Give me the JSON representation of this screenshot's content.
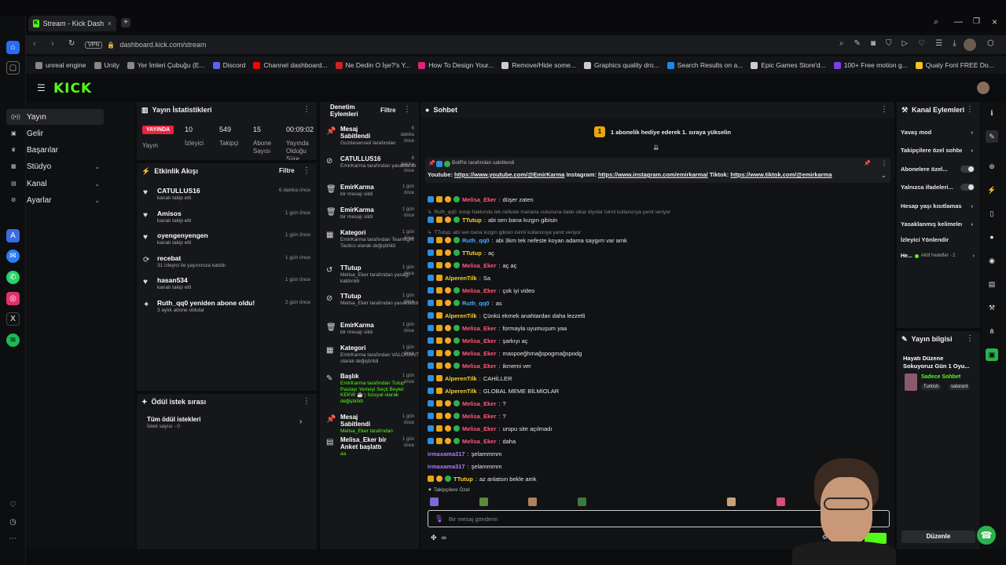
{
  "browser": {
    "tab_title": "Stream - Kick Dashboard",
    "vpn_label": "VPN",
    "url": "dashboard.kick.com/stream",
    "bookmarks": [
      {
        "label": "unreal engine",
        "color": "#888888"
      },
      {
        "label": "Unity",
        "color": "#888888"
      },
      {
        "label": "Yer İmleri Çubuğu (E...",
        "color": "#888888"
      },
      {
        "label": "Discord",
        "color": "#5865f2"
      },
      {
        "label": "Channel dashboard...",
        "color": "#ff0000"
      },
      {
        "label": "Ne Dedin O İşe?'s Y...",
        "color": "#cc2222"
      },
      {
        "label": "How To Design Your...",
        "color": "#e2227a"
      },
      {
        "label": "Remove/Hide some...",
        "color": "#cccccc"
      },
      {
        "label": "Graphics quality dro...",
        "color": "#cccccc"
      },
      {
        "label": "Search Results on a...",
        "color": "#1e88e5"
      },
      {
        "label": "Epic Games Store'd...",
        "color": "#cccccc"
      },
      {
        "label": "100+ Free motion g...",
        "color": "#7b3fe4"
      },
      {
        "label": "Qualy Font FREE Do...",
        "color": "#f5c518"
      }
    ]
  },
  "kick": {
    "logo": "KICK",
    "nav": [
      {
        "label": "Yayın",
        "icon": "broadcast-icon"
      },
      {
        "label": "Gelir",
        "icon": "money-icon"
      },
      {
        "label": "Başarılar",
        "icon": "trophy-icon"
      },
      {
        "label": "Stüdyo",
        "icon": "studio-icon"
      },
      {
        "label": "Kanal",
        "icon": "channel-icon"
      },
      {
        "label": "Ayarlar",
        "icon": "settings-icon"
      }
    ]
  },
  "stats": {
    "title": "Yayın İstatistikleri",
    "live_badge": "YAYINDA",
    "live_label": "Yayın",
    "viewers": "10",
    "viewers_label": "İzleyici",
    "followers": "549",
    "followers_label": "Takipçi",
    "subs": "15",
    "subs_label": "Abone Sayısı",
    "duration": "00:09:02",
    "duration_label": "Yayında Olduğu Süre"
  },
  "activity": {
    "title": "Etkinlik Akışı",
    "filter": "Filtre",
    "items": [
      {
        "name": "CATULLUS16",
        "sub": "kanalı takip etti",
        "time": "6 dakika önce",
        "icon": "♥"
      },
      {
        "name": "Amisos",
        "sub": "kanalı takip etti",
        "time": "1 gün önce",
        "icon": "♥"
      },
      {
        "name": "oyengenyengen",
        "sub": "kanalı takip etti",
        "time": "1 gün önce",
        "icon": "♥"
      },
      {
        "name": "recebat",
        "sub": "31 izleyici ile yayınınıza katıldı",
        "time": "1 gün önce",
        "icon": "⟳"
      },
      {
        "name": "hasan534",
        "sub": "kanalı takip etti",
        "time": "1 gün önce",
        "icon": "♥"
      },
      {
        "name": "Ruth_qq0 yeniden abone oldu!",
        "sub": "3 aylık abone oldular",
        "time": "2 gün önce",
        "icon": "✦"
      }
    ]
  },
  "rewards": {
    "title": "Ödül istek sırası",
    "all_label": "Tüm ödül istekleri",
    "count_label": "İstek sayısı - 0"
  },
  "mod": {
    "title": "Denetim Eylemleri",
    "filter": "Filtre",
    "items": [
      {
        "title": "Mesaj Sabitlendi",
        "sub": "Gozdesenseii tarafından",
        "time": "6 dakika önce",
        "icon": "📌"
      },
      {
        "title": "CATULLUS16",
        "sub": "EmirKarma tarafından yasaklandı",
        "time": "6 dakika önce",
        "icon": "⊘"
      },
      {
        "title": "EmirKarma",
        "sub": "bir mesajı sildi",
        "time": "1 gün önce",
        "icon": "🗑"
      },
      {
        "title": "EmirKarma",
        "sub": "bir mesajı sildi",
        "time": "1 gün önce",
        "icon": "🗑"
      },
      {
        "title": "Kategori",
        "sub": "EmirKarma tarafından Teamfight Tactics olarak değiştirildi",
        "time": "1 gün önce",
        "icon": "▦"
      },
      {
        "title": "TTutup",
        "sub": "Melisa_Eker tarafından yasağı kaldırıldı",
        "time": "1 gün önce",
        "icon": "↺"
      },
      {
        "title": "TTutup",
        "sub": "Melisa_Eker tarafından yasaklandı",
        "time": "1 gün önce",
        "icon": "⊘"
      },
      {
        "title": "EmirKarma",
        "sub": "bir mesajı sildi",
        "time": "1 gün önce",
        "icon": "🗑"
      },
      {
        "title": "Kategori",
        "sub": "EmirKarma tarafından VALORANT olarak değiştirildi",
        "time": "1 gün önce",
        "icon": "▦"
      },
      {
        "title": "Başlık",
        "sub": "EmirKarma tarafından Tutup Pastayı Yemeyi Seçti Beyler KEKW ☕️ | İsosyal olarak değiştirildi",
        "time": "1 gün önce",
        "icon": "✎"
      },
      {
        "title": "Mesaj Sabitlendi",
        "sub": "Melisa_Eker tarafından",
        "time": "1 gün önce",
        "icon": "📌"
      },
      {
        "title": "Melisa_Eker bir Anket başlattı",
        "sub": "aa",
        "time": "1 gün önce",
        "icon": "▤"
      }
    ]
  },
  "chat": {
    "title": "Sohbet",
    "gift_banner": "1 abonelik hediye ederek 1. sıraya yükselin",
    "gift_rank": "1",
    "pinned_by": "BotRix tarafından sabitlendi",
    "pinned_label": "Youtube:",
    "pinned_links": [
      "https://www.youtube.com/@EmirKarma",
      "https://www.instagram.com/emirkarma/",
      "https://www.tiktok.com/@emirkarma"
    ],
    "pinned_mid1": "Instagram:",
    "pinned_mid2": "Tiktok:",
    "messages": [
      {
        "user": "Melisa_Eker",
        "color": "red",
        "text": "düşer zaten",
        "badges": [
          "blue",
          "gold",
          "orange",
          "green"
        ]
      },
      {
        "reply": "Ruth_qq0: tutup hakkında tek nefeste mariana cukuruna dalar cikar diyolar isimli kullanıcıya yanıt veriyor"
      },
      {
        "user": "TTutup",
        "color": "gold",
        "text": "abi sen bana kızgın gibisin",
        "badges": [
          "blue",
          "gold",
          "orange",
          "green"
        ]
      },
      {
        "reply": "TTutup: abi sen bana kızgın gibisin isimli kullanıcıya yanıt veriyor"
      },
      {
        "user": "Ruth_qq0",
        "color": "blue",
        "text": "abi 3km tek nefeste koyan adama saygım var amk",
        "badges": [
          "blue",
          "gold",
          "orange",
          "green"
        ]
      },
      {
        "user": "TTutup",
        "color": "gold",
        "text": "aç",
        "badges": [
          "blue",
          "gold",
          "orange",
          "green"
        ]
      },
      {
        "user": "Melisa_Eker",
        "color": "red",
        "text": "aç aç",
        "badges": [
          "blue",
          "gold",
          "orange",
          "green"
        ]
      },
      {
        "user": "AlperenTilk",
        "color": "gold",
        "text": "Sa",
        "badges": [
          "blue",
          "gold"
        ]
      },
      {
        "user": "Melisa_Eker",
        "color": "red",
        "text": "çok iyi video",
        "badges": [
          "blue",
          "gold",
          "orange",
          "green"
        ]
      },
      {
        "user": "Ruth_qq0",
        "color": "blue",
        "text": "as",
        "badges": [
          "blue",
          "gold",
          "orange",
          "green"
        ]
      },
      {
        "user": "AlperenTilk",
        "color": "gold",
        "text": "Çünkü ekmek anahtardan daha lezzetli",
        "badges": [
          "blue",
          "gold"
        ]
      },
      {
        "user": "Melisa_Eker",
        "color": "red",
        "text": "formayla uyumuşum yaa",
        "badges": [
          "blue",
          "gold",
          "orange",
          "green"
        ]
      },
      {
        "user": "Melisa_Eker",
        "color": "red",
        "text": "şarkıyı aç",
        "badges": [
          "blue",
          "gold",
          "orange",
          "green"
        ]
      },
      {
        "user": "Melisa_Eker",
        "color": "red",
        "text": "maspoeğhmağspogmağspodg",
        "badges": [
          "blue",
          "gold",
          "orange",
          "green"
        ]
      },
      {
        "user": "Melisa_Eker",
        "color": "red",
        "text": "ikmemi ver",
        "badges": [
          "blue",
          "gold",
          "orange",
          "green"
        ]
      },
      {
        "user": "AlperenTilk",
        "color": "gold",
        "text": "CAHİLLER",
        "badges": [
          "blue",
          "gold"
        ]
      },
      {
        "user": "AlperenTilk",
        "color": "gold",
        "text": "GLOBAL MEME BİLMİOLAR",
        "badges": [
          "blue",
          "gold"
        ]
      },
      {
        "user": "Melisa_Eker",
        "color": "red",
        "text": "?",
        "badges": [
          "blue",
          "gold",
          "orange",
          "green"
        ]
      },
      {
        "user": "Melisa_Eker",
        "color": "red",
        "text": "?",
        "badges": [
          "blue",
          "gold",
          "orange",
          "green"
        ]
      },
      {
        "user": "Melisa_Eker",
        "color": "red",
        "text": "urspu site açılmadı",
        "badges": [
          "blue",
          "gold",
          "orange",
          "green"
        ]
      },
      {
        "user": "Melisa_Eker",
        "color": "red",
        "text": "daha",
        "badges": [
          "blue",
          "gold",
          "orange",
          "green"
        ]
      },
      {
        "user": "irmaxama317",
        "color": "purple",
        "text": "şelammmm",
        "badges": []
      },
      {
        "user": "irmaxama317",
        "color": "purple",
        "text": "şelammmm",
        "badges": []
      },
      {
        "user": "TTutup",
        "color": "gold",
        "text": "az anlatsın bekle amk",
        "badges": [
          "gold",
          "orange",
          "green"
        ]
      }
    ],
    "followers_only": "Takipçilere Özel",
    "input_placeholder": "Bir mesaj gönderin"
  },
  "channel_actions": {
    "title": "Kanal Eylemleri",
    "items": [
      {
        "label": "Yavaş mod",
        "type": "arrow"
      },
      {
        "label": "Takipçilere özel sohbet",
        "type": "arrow"
      },
      {
        "label": "Abonelere özel...",
        "type": "toggle"
      },
      {
        "label": "Yalnızca ifadeleri...",
        "type": "toggle"
      },
      {
        "label": "Hesap yaşı kısıtlaması",
        "type": "arrow"
      },
      {
        "label": "Yasaklanmış kelimeler",
        "type": "arrow"
      },
      {
        "label": "İzleyici Yönlendir",
        "type": "none"
      }
    ],
    "goals_label": "He...",
    "goals_sub": "Aktif hedefler - 2"
  },
  "stream_info": {
    "title": "Yayın bilgisi",
    "stream_title": "Hayatı Düzene Sokuyoruz Gün 1 Oyu...",
    "chat_mode": "Sadece Sohbet",
    "tags": [
      "Turkish",
      "valorant"
    ],
    "edit_button": "Düzenle"
  }
}
